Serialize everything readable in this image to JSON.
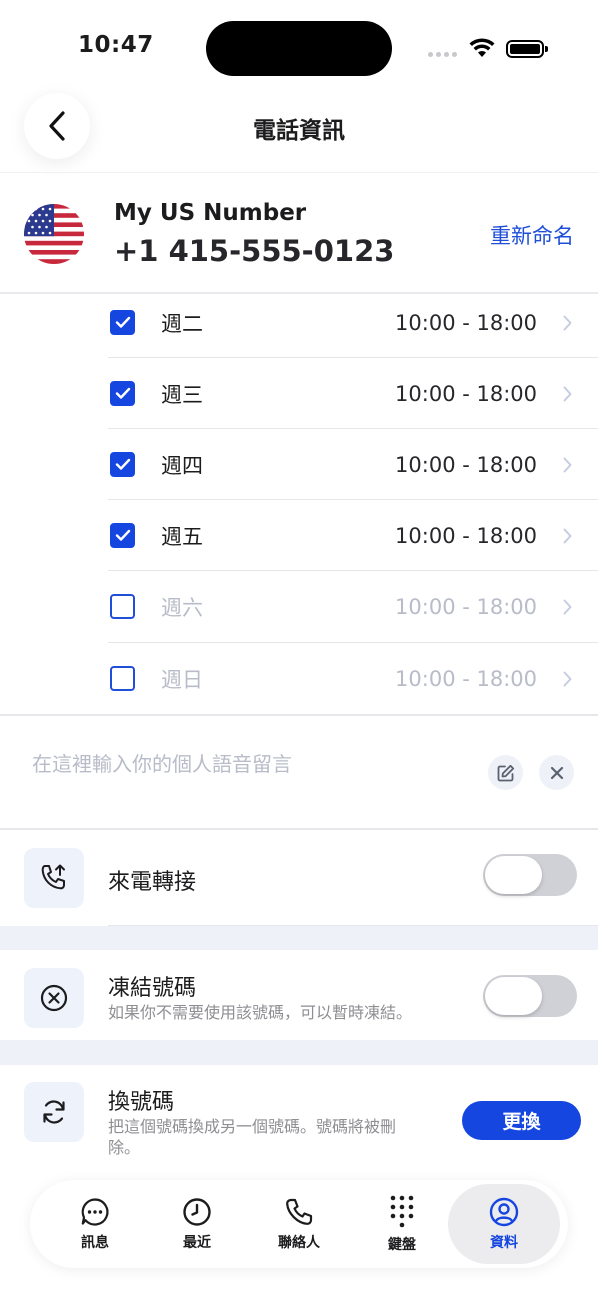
{
  "status_bar": {
    "time": "10:47"
  },
  "header": {
    "title": "電話資訊"
  },
  "number": {
    "name": "My US Number",
    "value": "+1 415-555-0123",
    "rename_label": "重新命名"
  },
  "schedule": [
    {
      "day": "週二",
      "time": "10:00 - 18:00",
      "checked": true
    },
    {
      "day": "週三",
      "time": "10:00 - 18:00",
      "checked": true
    },
    {
      "day": "週四",
      "time": "10:00 - 18:00",
      "checked": true
    },
    {
      "day": "週五",
      "time": "10:00 - 18:00",
      "checked": true
    },
    {
      "day": "週六",
      "time": "10:00 - 18:00",
      "checked": false
    },
    {
      "day": "週日",
      "time": "10:00 - 18:00",
      "checked": false
    }
  ],
  "voicemail": {
    "placeholder": "在這裡輸入你的個人語音留言"
  },
  "call_forwarding": {
    "title": "來電轉接",
    "enabled": false
  },
  "freeze": {
    "title": "凍結號碼",
    "desc": "如果你不需要使用該號碼，可以暫時凍結。",
    "enabled": false
  },
  "change": {
    "title": "換號碼",
    "desc": "把這個號碼換成另一個號碼。號碼將被刪除。",
    "button": "更換"
  },
  "tabs": [
    {
      "label": "訊息",
      "icon": "message-icon"
    },
    {
      "label": "最近",
      "icon": "clock-icon"
    },
    {
      "label": "聯絡人",
      "icon": "phone-icon"
    },
    {
      "label": "鍵盤",
      "icon": "keypad-icon"
    },
    {
      "label": "資料",
      "icon": "profile-icon",
      "active": true
    }
  ],
  "colors": {
    "accent": "#1546e0",
    "toggle_off": "#cfd1d6",
    "band": "#eef1f7"
  }
}
